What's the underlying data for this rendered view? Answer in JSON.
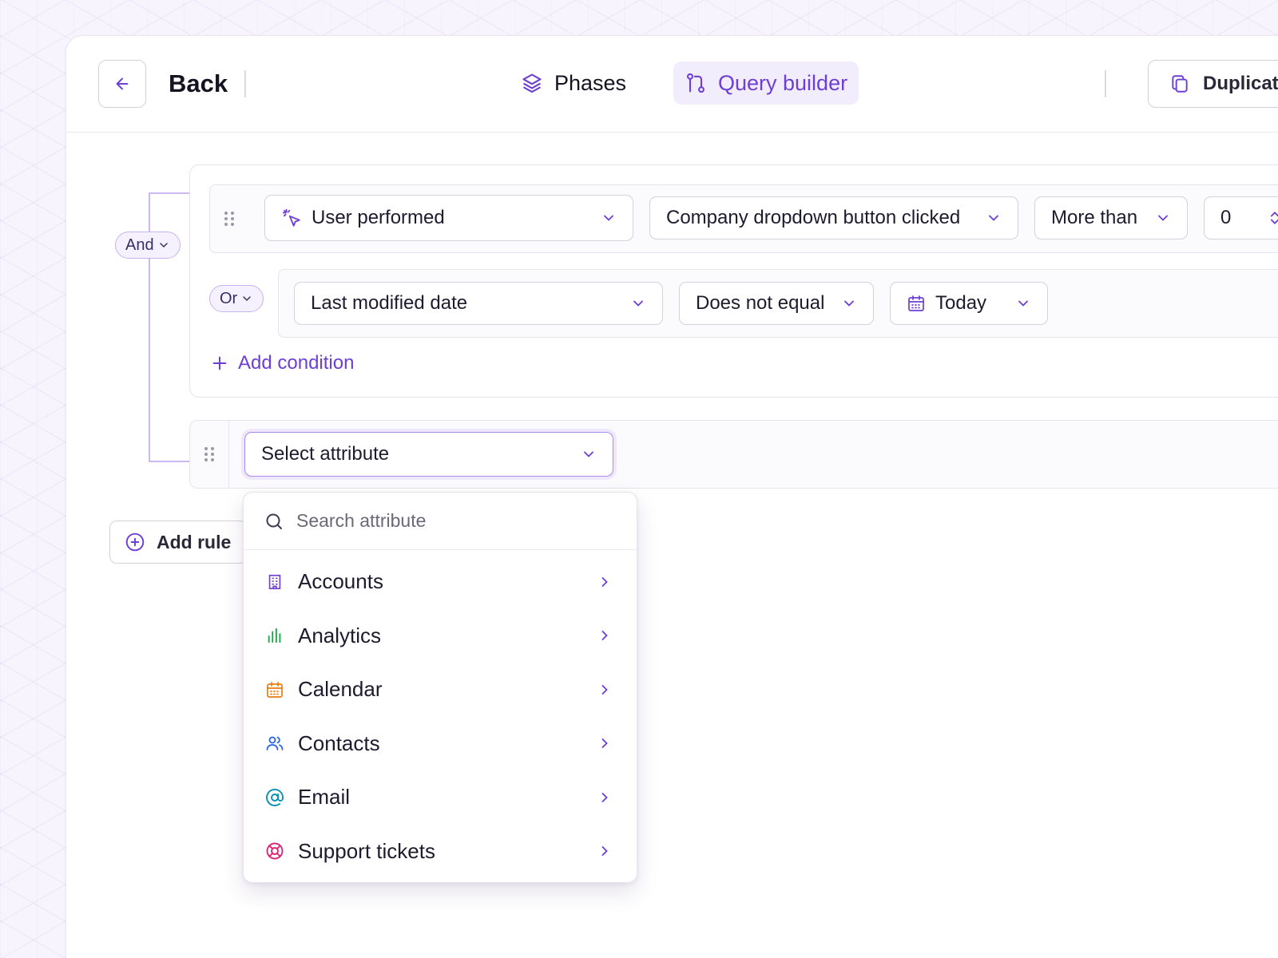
{
  "header": {
    "back_label": "Back",
    "tabs": [
      {
        "label": "Phases",
        "icon": "layers-icon",
        "active": false
      },
      {
        "label": "Query builder",
        "icon": "git-pull-request-icon",
        "active": true
      }
    ],
    "duplicate_label": "Duplicate"
  },
  "builder": {
    "and_label": "And",
    "or_label": "Or",
    "row1": {
      "type_value": "User performed",
      "event_value": "Company dropdown button clicked",
      "operator_value": "More than",
      "count_value": "0"
    },
    "row2": {
      "attribute_value": "Last modified date",
      "operator_value": "Does not equal",
      "date_value": "Today"
    },
    "add_condition_label": "Add condition",
    "row3": {
      "attribute_placeholder": "Select attribute"
    },
    "add_rule_label": "Add rule"
  },
  "dropdown": {
    "search_placeholder": "Search attribute",
    "items": [
      {
        "label": "Accounts",
        "icon": "building-icon",
        "color": "#6d3fd4"
      },
      {
        "label": "Analytics",
        "icon": "bar-chart-icon",
        "color": "#16a34a"
      },
      {
        "label": "Calendar",
        "icon": "calendar-icon",
        "color": "#ea7a12"
      },
      {
        "label": "Contacts",
        "icon": "users-icon",
        "color": "#2563eb"
      },
      {
        "label": "Email",
        "icon": "at-sign-icon",
        "color": "#0891b2"
      },
      {
        "label": "Support tickets",
        "icon": "life-buoy-icon",
        "color": "#db2777"
      }
    ]
  },
  "colors": {
    "accent": "#6d3fd4",
    "accent_bg": "#f2edfc"
  }
}
